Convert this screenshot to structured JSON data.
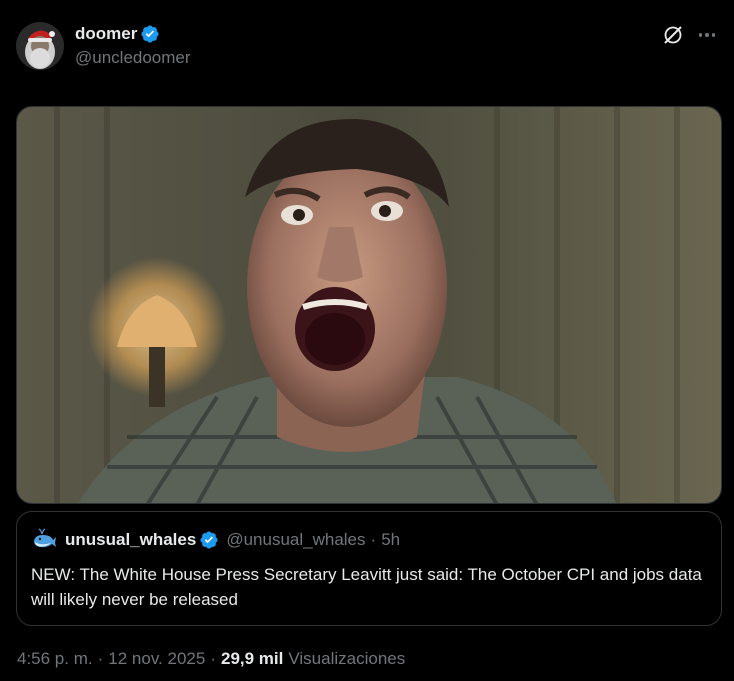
{
  "post": {
    "display_name": "doomer",
    "handle": "@uncledoomer",
    "avatar_icon": "santa-avatar-icon",
    "media_alt_icon": "screaming-man-photo"
  },
  "quote": {
    "display_name": "unusual_whales",
    "handle": "@unusual_whales",
    "dot": "·",
    "time": "5h",
    "text": "NEW: The White House Press Secretary Leavitt just said: The October CPI and jobs data will likely never be released"
  },
  "meta": {
    "time": "4:56 p. m.",
    "sep1": "·",
    "date": "12 nov. 2025",
    "sep2": "·",
    "views_count": "29,9 mil",
    "views_label": "Visualizaciones"
  },
  "colors": {
    "background": "#000000",
    "text_primary": "#e7e9ea",
    "text_secondary": "#71767b",
    "verified": "#1d9bf0",
    "border": "#2f3336"
  }
}
